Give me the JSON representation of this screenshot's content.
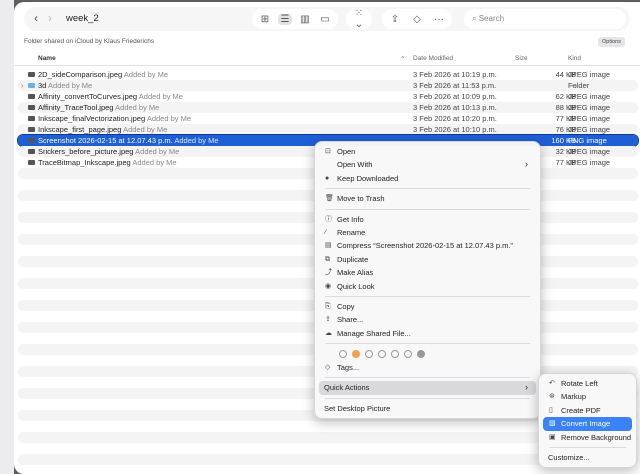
{
  "toolbar": {
    "title": "week_2",
    "back": "‹",
    "forward": "›",
    "search_placeholder": "Search",
    "more": "···"
  },
  "shared_text": "Folder shared on iCloud by Klaus Friederichs",
  "options_label": "Options",
  "columns": {
    "name": "Name",
    "date": "Date Modified",
    "size": "Size",
    "kind": "Kind"
  },
  "files": [
    {
      "name": "2D_sideComparison.jpeg",
      "added": "Added by Me",
      "date": "3 Feb 2026 at 10:19 p.m.",
      "size": "44 KB",
      "kind": "JPEG image"
    },
    {
      "name": "3d",
      "added": "Added by Me",
      "date": "3 Feb 2026 at 11:53 p.m.",
      "size": "--",
      "kind": "Folder"
    },
    {
      "name": "Affinity_convertToCurves.jpeg",
      "added": "Added by Me",
      "date": "3 Feb 2026 at 10:09 p.m.",
      "size": "62 KB",
      "kind": "JPEG image"
    },
    {
      "name": "Affinity_TraceTool.jpeg",
      "added": "Added by Me",
      "date": "3 Feb 2026 at 10:13 p.m.",
      "size": "88 KB",
      "kind": "JPEG image"
    },
    {
      "name": "Inkscape_finalVectorization.jpeg",
      "added": "Added by Me",
      "date": "3 Feb 2026 at 10:20 p.m.",
      "size": "77 KB",
      "kind": "JPEG image"
    },
    {
      "name": "Inkscape_first_page.jpeg",
      "added": "Added by Me",
      "date": "3 Feb 2026 at 10:10 p.m.",
      "size": "76 KB",
      "kind": "JPEG image"
    },
    {
      "name": "Screenshot 2026-02-15 at 12.07.43 p.m.",
      "added": "Added by Me",
      "date": "",
      "size": "160 KB",
      "kind": "PNG image"
    },
    {
      "name": "Srickers_before_picture.jpeg",
      "added": "Added by Me",
      "date": "",
      "size": "32 KB",
      "kind": "JPEG image"
    },
    {
      "name": "TraceBitmap_Inkscape.jpeg",
      "added": "Added by Me",
      "date": "",
      "size": "77 KB",
      "kind": "JPEG image"
    }
  ],
  "menu": {
    "open": "Open",
    "open_with": "Open With",
    "keep_downloaded": "Keep Downloaded",
    "move_to_trash": "Move to Trash",
    "get_info": "Get Info",
    "rename": "Rename",
    "compress": "Compress “Screenshot 2026-02-15 at 12.07.43 p.m.”",
    "duplicate": "Duplicate",
    "make_alias": "Make Alias",
    "quick_look": "Quick Look",
    "copy": "Copy",
    "share": "Share...",
    "manage_shared": "Manage Shared File...",
    "tags": "Tags...",
    "quick_actions": "Quick Actions",
    "set_desktop": "Set Desktop Picture"
  },
  "tag_colors": [
    "none",
    "#f0a050",
    "none",
    "none",
    "none",
    "none",
    "#999999"
  ],
  "submenu": {
    "rotate_left": "Rotate Left",
    "markup": "Markup",
    "create_pdf": "Create PDF",
    "convert_image": "Convert Image",
    "remove_background": "Remove Background",
    "customize": "Customize..."
  }
}
